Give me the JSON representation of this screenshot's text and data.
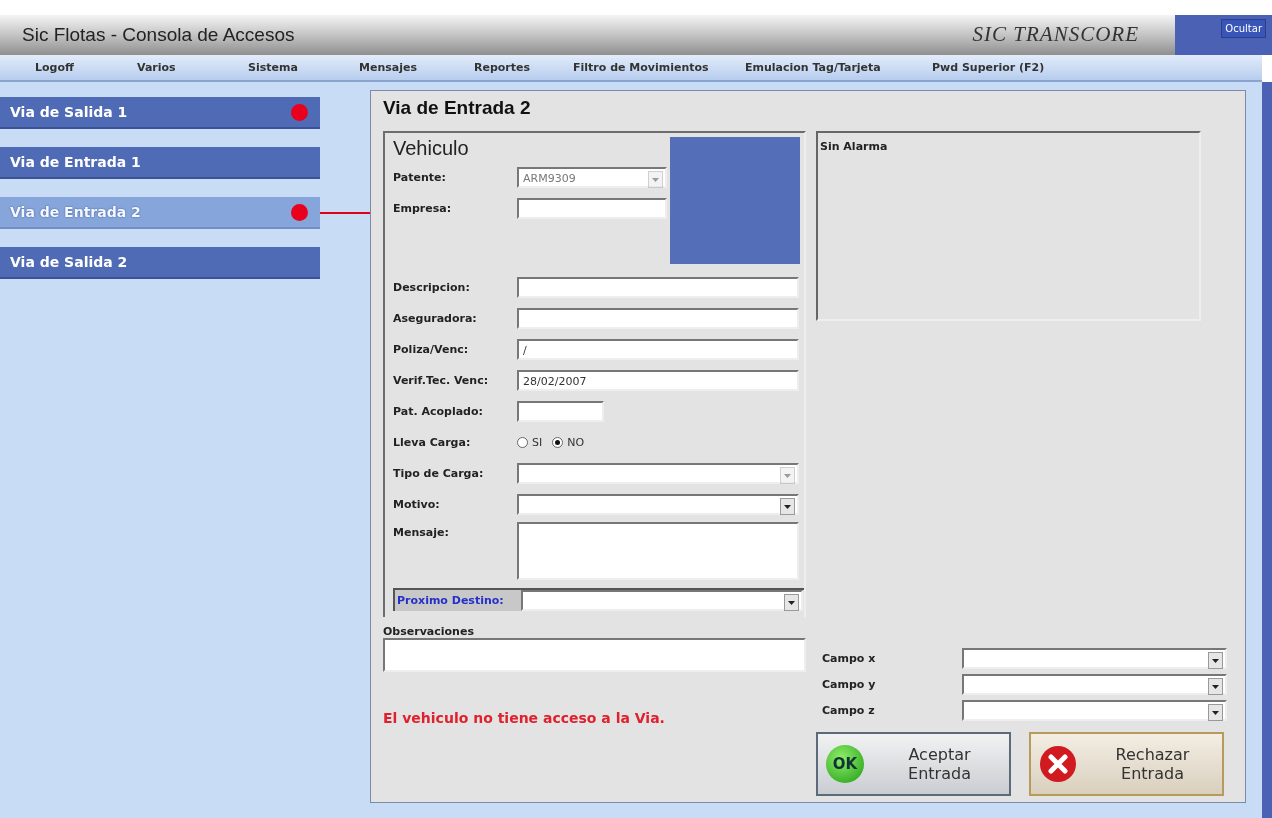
{
  "window": {
    "title": "Sic Flotas - Consola de Accesos",
    "logo": "SIC TRANSCORE",
    "hide_button": "Ocultar"
  },
  "menu": [
    "Logoff",
    "Varios",
    "Sistema",
    "Mensajes",
    "Reportes",
    "Filtro de Movimientos",
    "Emulacion Tag/Tarjeta",
    "Pwd Superior (F2)"
  ],
  "lanes": [
    {
      "label": "Via de Salida 1",
      "selected": false,
      "alert": true
    },
    {
      "label": "Via de Entrada 1",
      "selected": false,
      "alert": false
    },
    {
      "label": "Via de Entrada 2",
      "selected": true,
      "alert": true
    },
    {
      "label": "Via de Salida 2",
      "selected": false,
      "alert": false
    }
  ],
  "panel": {
    "title": "Via de Entrada 2",
    "vehicle": {
      "title": "Vehiculo",
      "fields": [
        {
          "kind": "combo",
          "label": "Patente:",
          "value": "ARM9309",
          "disabled": true
        },
        {
          "kind": "text",
          "label": "Empresa:"
        },
        {
          "kind": "text",
          "label": "Descripcion:"
        },
        {
          "kind": "text",
          "label": "Aseguradora:"
        },
        {
          "kind": "text",
          "label": "Poliza/Venc:",
          "value": "/"
        },
        {
          "kind": "text",
          "label": "Verif.Tec. Venc:",
          "value": "28/02/2007"
        },
        {
          "kind": "text",
          "label": "Pat. Acoplado:"
        },
        {
          "kind": "radio",
          "label": "Lleva Carga:",
          "options": [
            {
              "label": "SI",
              "selected": false
            },
            {
              "label": "NO",
              "selected": true
            }
          ]
        },
        {
          "kind": "combo",
          "label": "Tipo de Carga:",
          "disabled": true
        },
        {
          "kind": "combo",
          "label": "Motivo:",
          "disabled": false
        },
        {
          "kind": "textarea",
          "label": "Mensaje:"
        }
      ],
      "next_destination": {
        "label": "Proximo Destino:"
      }
    },
    "observations": {
      "label": "Observaciones"
    },
    "error": "El vehiculo no tiene acceso a la Via.",
    "alarm": "Sin Alarma",
    "extra_fields": [
      {
        "label": "Campo x"
      },
      {
        "label": "Campo y"
      },
      {
        "label": "Campo z"
      }
    ],
    "buttons": [
      {
        "kind": "accept",
        "icon_text": "OK",
        "label_1": "Aceptar",
        "label_2": "Entrada"
      },
      {
        "kind": "reject",
        "label_1": "Rechazar",
        "label_2": "Entrada"
      }
    ]
  }
}
